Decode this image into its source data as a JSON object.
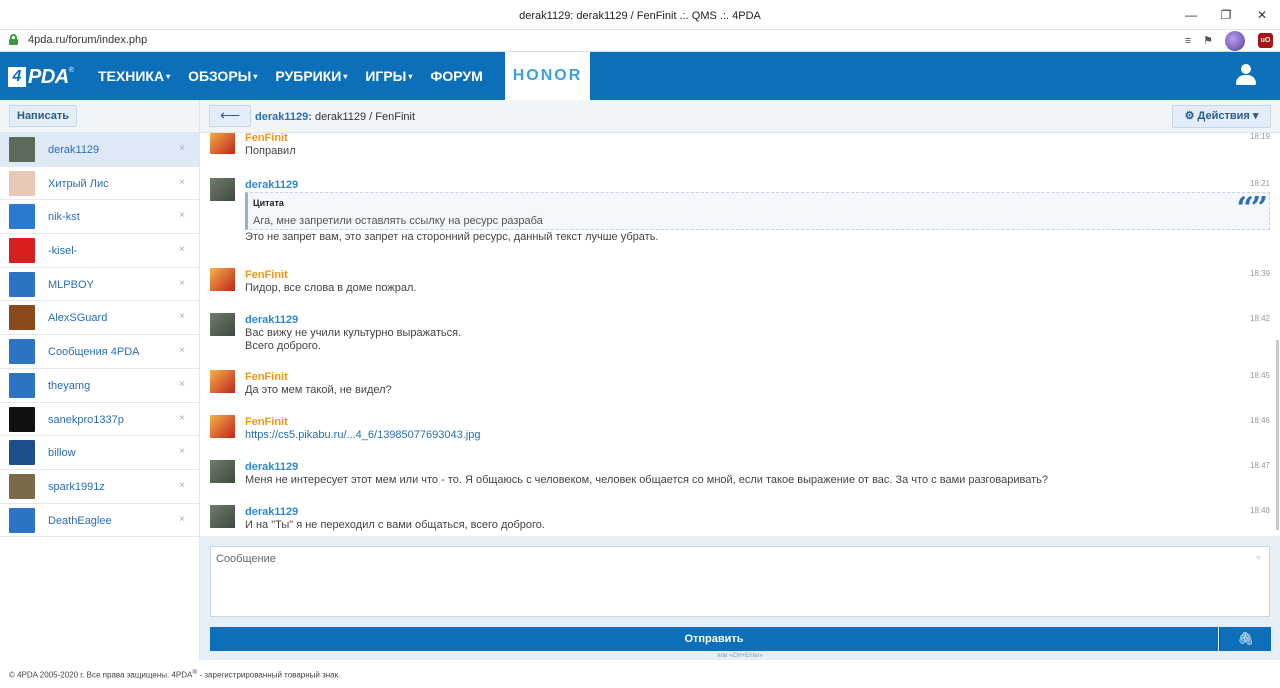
{
  "browser": {
    "title": "derak1129: derak1129 / FenFinit .:. QMS .:. 4PDA",
    "url": "4pda.ru/forum/index.php",
    "minimize": "—",
    "restore": "❐",
    "close": "✕",
    "reader_icon": "≡",
    "bookmark_icon": "⚑",
    "ublock_label": "uO"
  },
  "site": {
    "logo_four": "4",
    "logo_text": "PDA",
    "logo_reg": "®",
    "nav": [
      {
        "label": "ТЕХНИКА",
        "caret": "▾"
      },
      {
        "label": "ОБЗОРЫ",
        "caret": "▾"
      },
      {
        "label": "РУБРИКИ",
        "caret": "▾"
      },
      {
        "label": "ИГРЫ",
        "caret": "▾"
      },
      {
        "label": "ФОРУМ",
        "caret": ""
      }
    ],
    "promo": "HONOR"
  },
  "sidebar": {
    "write_label": "Написать",
    "close_glyph": "×",
    "contacts": [
      {
        "name": "derak1129",
        "color": "#5b6a5a"
      },
      {
        "name": "Хитрый Лис",
        "color": "#e9c7b7"
      },
      {
        "name": "nik-kst",
        "color": "#2a7bd0"
      },
      {
        "name": "-kisel-",
        "color": "#d81e1e"
      },
      {
        "name": "MLPBOY",
        "color": "#2b74c4"
      },
      {
        "name": "AlexSGuard",
        "color": "#8b4a1e"
      },
      {
        "name": "Сообщения 4PDA",
        "color": "#2b74c4"
      },
      {
        "name": "theyamg",
        "color": "#2b74c4"
      },
      {
        "name": "sanekpro1337p",
        "color": "#111111"
      },
      {
        "name": "billow",
        "color": "#1d4f8c"
      },
      {
        "name": "spark1991z",
        "color": "#7a6a4a"
      },
      {
        "name": "DeathEaglee",
        "color": "#2b74c4"
      }
    ]
  },
  "thread": {
    "back_glyph": "⟵",
    "owner": "derak1129:",
    "title": " derak1129 / FenFinit",
    "actions_label": "⚙ Действия ▾"
  },
  "messages": [
    {
      "author": "FenFinit",
      "time": "18:19",
      "lines": [
        "Поправил"
      ]
    },
    {
      "author": "derak1129",
      "time": "18:21",
      "quote_header": "Цитата",
      "quote_text": "Ага, мне запретили оставлять ссылку на ресурс разраба",
      "lines": [
        "Это не запрет вам, это запрет на сторонний ресурс, данный текст лучше убрать."
      ]
    },
    {
      "author": "FenFinit",
      "time": "18:39",
      "lines": [
        "Пидор, все слова в доме пожрал."
      ]
    },
    {
      "author": "derak1129",
      "time": "18:42",
      "lines": [
        "Вас вижу не учили культурно выражаться.",
        "Всего доброго."
      ]
    },
    {
      "author": "FenFinit",
      "time": "18:45",
      "lines": [
        "Да это мем такой, не видел?"
      ]
    },
    {
      "author": "FenFinit",
      "time": "18:46",
      "link": "https://cs5.pikabu.ru/...4_6/13985077693043.jpg"
    },
    {
      "author": "derak1129",
      "time": "18:47",
      "lines": [
        "Меня не интересует этот мем или что - то. Я общаюсь с человеком, человек общается со мной, если такое выражение от вас. За что с вами разговаривать?"
      ]
    },
    {
      "author": "derak1129",
      "time": "18:48",
      "lines": [
        "И на \"Ты\" я не переходил с вами общаться, всего доброго."
      ]
    }
  ],
  "compose": {
    "placeholder": "Сообщение",
    "smile": "○",
    "send_label": "Отправить",
    "attach_glyph": "🖇",
    "hint": "или «Ctrl+Enter»"
  },
  "footer": {
    "text_before": "© 4PDA 2005-2020 г. Все права защищены. 4PDA",
    "reg": "®",
    "text_after": " - зарегистрированный товарный знак."
  }
}
